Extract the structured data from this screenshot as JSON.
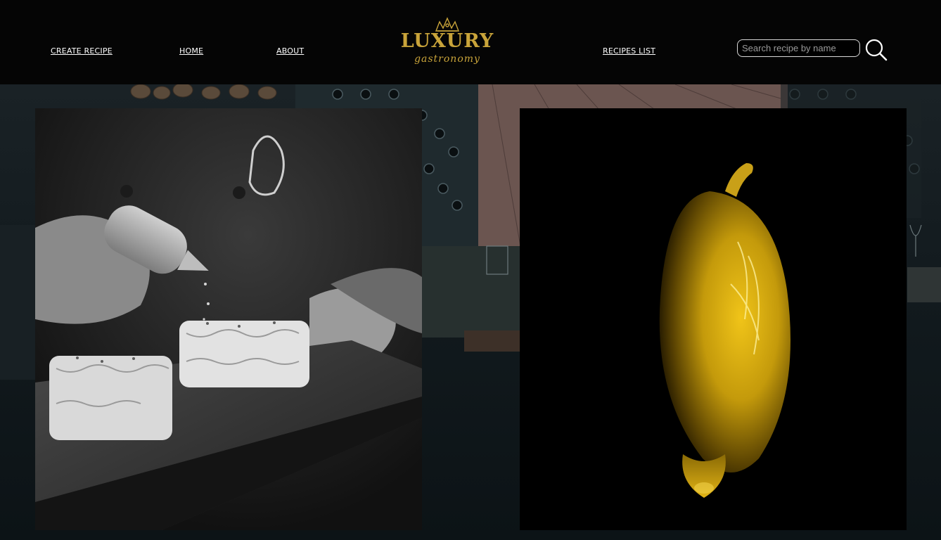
{
  "nav": {
    "create_recipe": "CREATE RECIPE",
    "home": "HOME",
    "about": "ABOUT",
    "recipes_list": "RECIPES LIST"
  },
  "logo": {
    "brand": "LUXURY",
    "tagline": "gastronomy",
    "color": "#c9a43a"
  },
  "search": {
    "placeholder": "Search recipe by name",
    "value": "",
    "icon": "search-icon"
  },
  "photos": {
    "left": {
      "icon": "sushi-plating-photo"
    },
    "right": {
      "icon": "olive-oil-drop-photo",
      "accent": "#d4a60c"
    }
  }
}
